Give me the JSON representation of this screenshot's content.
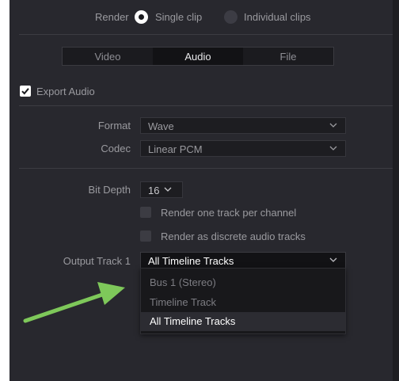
{
  "render": {
    "label": "Render",
    "options": [
      {
        "label": "Single clip",
        "selected": true
      },
      {
        "label": "Individual clips",
        "selected": false
      }
    ]
  },
  "tabs": [
    {
      "label": "Video",
      "active": false
    },
    {
      "label": "Audio",
      "active": true
    },
    {
      "label": "File",
      "active": false
    }
  ],
  "export_audio": {
    "label": "Export Audio",
    "checked": true
  },
  "format": {
    "label": "Format",
    "value": "Wave"
  },
  "codec": {
    "label": "Codec",
    "value": "Linear PCM"
  },
  "bit_depth": {
    "label": "Bit Depth",
    "value": "16"
  },
  "render_one_track": {
    "label": "Render one track per channel",
    "checked": false
  },
  "render_discrete": {
    "label": "Render as discrete audio tracks",
    "checked": false
  },
  "output_track": {
    "label": "Output Track 1",
    "value": "All Timeline Tracks",
    "options": [
      "Bus 1 (Stereo)",
      "Timeline Track",
      "All Timeline Tracks"
    ],
    "highlighted": "All Timeline Tracks"
  },
  "icons": [
    "checkmark-icon",
    "chevron-down-icon",
    "radio-button-icon",
    "annotation-arrow"
  ],
  "colors": {
    "panel": "#28282e",
    "arrow": "#7ec85a",
    "field": "#1d1d21"
  }
}
